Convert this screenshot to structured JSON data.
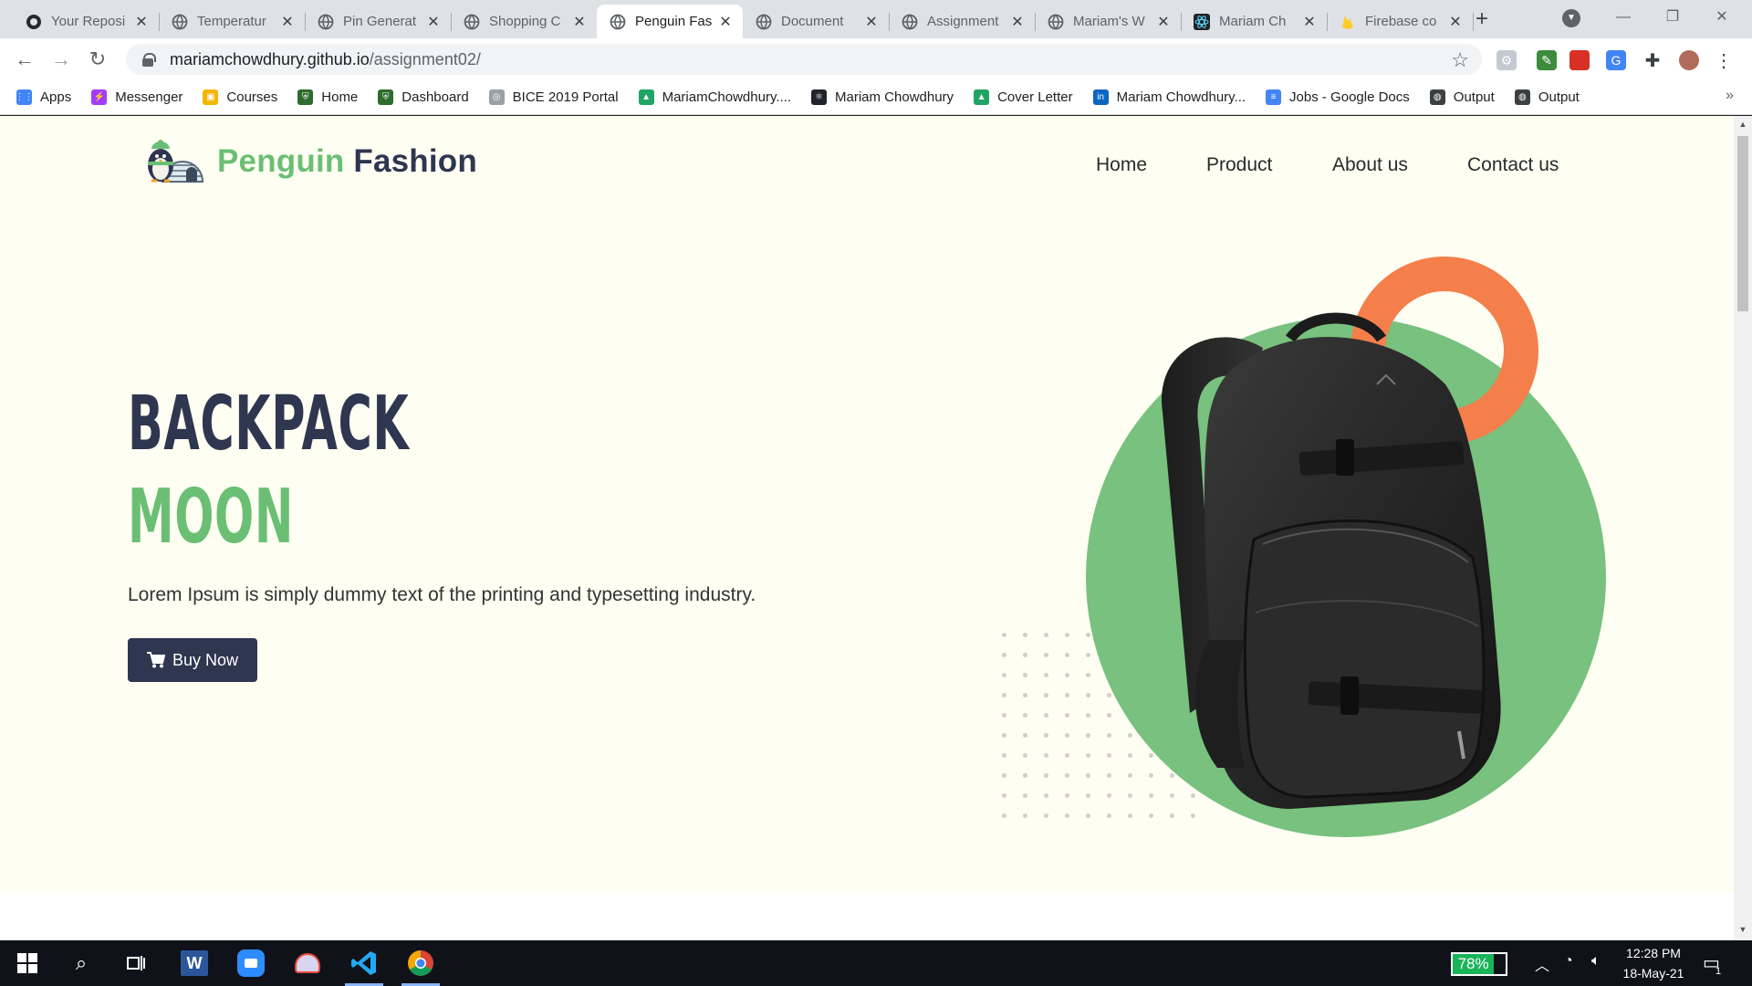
{
  "browser": {
    "tabs": [
      {
        "title": "Your Reposi",
        "icon": "github-icon",
        "active": false
      },
      {
        "title": "Temperatur",
        "icon": "globe-icon",
        "active": false
      },
      {
        "title": "Pin Generat",
        "icon": "globe-icon",
        "active": false
      },
      {
        "title": "Shopping C",
        "icon": "globe-icon",
        "active": false
      },
      {
        "title": "Penguin Fas",
        "icon": "globe-icon",
        "active": true
      },
      {
        "title": "Document",
        "icon": "globe-icon",
        "active": false
      },
      {
        "title": "Assignment",
        "icon": "globe-icon",
        "active": false
      },
      {
        "title": "Mariam's W",
        "icon": "globe-icon",
        "active": false
      },
      {
        "title": "Mariam Ch",
        "icon": "react-icon",
        "active": false
      },
      {
        "title": "Firebase co",
        "icon": "firebase-icon",
        "active": false
      }
    ],
    "url_host": "mariamchowdhury.github.io",
    "url_path": "/assignment02/",
    "bookmarks": [
      {
        "label": "Apps",
        "icon": "apps-grid-icon",
        "color": "#4285f4"
      },
      {
        "label": "Messenger",
        "icon": "messenger-icon",
        "color": "#a33bfa"
      },
      {
        "label": "Courses",
        "icon": "classroom-icon",
        "color": "#f2b600"
      },
      {
        "label": "Home",
        "icon": "school-crest-icon",
        "color": "#2e6b2e"
      },
      {
        "label": "Dashboard",
        "icon": "school-crest-icon",
        "color": "#2e6b2e"
      },
      {
        "label": "BICE 2019 Portal",
        "icon": "portal-icon",
        "color": "#9aa0a6"
      },
      {
        "label": "MariamChowdhury....",
        "icon": "drive-icon",
        "color": "#1fa463"
      },
      {
        "label": "Mariam Chowdhury",
        "icon": "react-icon",
        "color": "#20232a"
      },
      {
        "label": "Cover Letter",
        "icon": "drive-icon",
        "color": "#1fa463"
      },
      {
        "label": "Mariam Chowdhury...",
        "icon": "linkedin-icon",
        "color": "#0a66c2"
      },
      {
        "label": "Jobs - Google Docs",
        "icon": "docs-icon",
        "color": "#4285f4"
      },
      {
        "label": "Output",
        "icon": "globe-icon",
        "color": "#3c4043"
      },
      {
        "label": "Output",
        "icon": "globe-icon",
        "color": "#3c4043"
      }
    ],
    "more_bookmarks": "»"
  },
  "site": {
    "logo_part1": "Penguin",
    "logo_part2": "Fashion",
    "nav": [
      "Home",
      "Product",
      "About us",
      "Contact us"
    ],
    "headline_line1": "BACKPACK",
    "headline_line2": "MOON",
    "tagline": "Lorem Ipsum is simply dummy text of the printing and typesetting industry.",
    "buy_label": "Buy Now",
    "colors": {
      "brand_dark": "#2e3650",
      "brand_green": "#6abf74",
      "accent_orange": "#f47f4a",
      "hero_bg": "#fffef2"
    }
  },
  "taskbar": {
    "battery_percent": "78%",
    "battery_level": 0.78,
    "time": "12:28 PM",
    "date": "18-May-21",
    "notification_count": "1"
  }
}
